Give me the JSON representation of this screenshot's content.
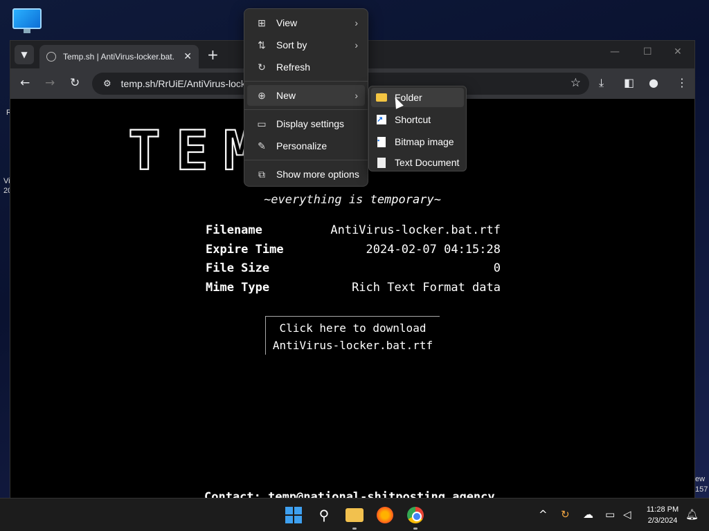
{
  "desktop": {
    "edge_texts": [
      "R",
      "Vi",
      "20",
      "ew",
      "157"
    ]
  },
  "browser": {
    "tab_title": "Temp.sh | AntiVirus-locker.bat.rtf",
    "tab_close": "✕",
    "new_tab": "+",
    "url": "temp.sh/RrUiE/AntiVirus-locker.bat.rtf"
  },
  "page": {
    "logo_text": "TEMP.SH",
    "tagline": "~everything is temporary~",
    "info": [
      {
        "key": "Filename",
        "value": "AntiVirus-locker.bat.rtf"
      },
      {
        "key": "Expire Time",
        "value": "2024-02-07 04:15:28"
      },
      {
        "key": "File Size",
        "value": "0"
      },
      {
        "key": "Mime Type",
        "value": "Rich Text Format data"
      }
    ],
    "download_line1": "Click here to download",
    "download_line2": "AntiVirus-locker.bat.rtf",
    "contact": "Contact: temp@national-shitposting.agency"
  },
  "context_menu": {
    "items": [
      {
        "label": "View",
        "icon": "view-icon"
      },
      {
        "label": "Sort by",
        "icon": "sort-icon"
      },
      {
        "label": "Refresh",
        "icon": "refresh-icon"
      },
      {
        "label": "New",
        "icon": "new-icon"
      },
      {
        "label": "Display settings",
        "icon": "display-icon"
      },
      {
        "label": "Personalize",
        "icon": "brush-icon"
      },
      {
        "label": "Show more options",
        "icon": "more-options-icon"
      }
    ]
  },
  "new_submenu": {
    "items": [
      {
        "label": "Folder",
        "icon": "folder-icon"
      },
      {
        "label": "Shortcut",
        "icon": "shortcut-icon"
      },
      {
        "label": "Bitmap image",
        "icon": "bitmap-icon"
      },
      {
        "label": "Text Document",
        "icon": "text-document-icon"
      }
    ]
  },
  "taskbar": {
    "time": "11:28 PM",
    "date": "2/3/2024"
  },
  "colors": {
    "accent": "#3ea0f0",
    "menu_bg": "#2c2c2c",
    "page_bg": "#000000"
  }
}
